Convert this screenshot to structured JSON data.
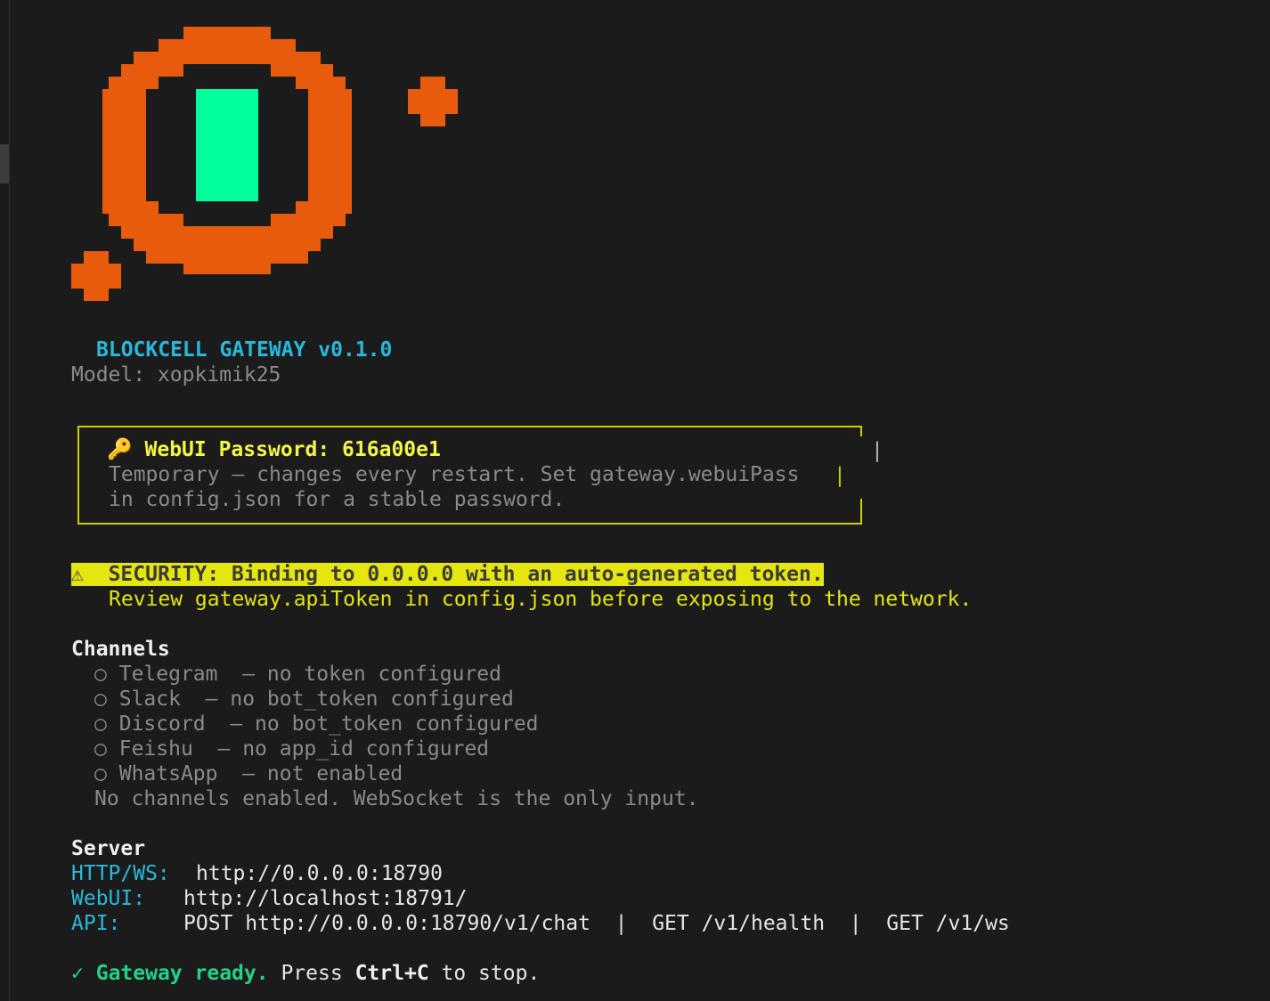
{
  "logo": {
    "name": "blockcell-pixel-logo-icon",
    "ring_color": "#e85b0c",
    "core_color": "#00ff9c"
  },
  "header": {
    "title": "BLOCKCELL GATEWAY v0.1.0",
    "model": "Model: xopkimik25"
  },
  "password_box": {
    "icon": "🔑",
    "label": "WebUI Password: 616a00e1",
    "line1": "Temporary — changes every restart. Set gateway.webuiPass",
    "line2": "in config.json for a stable password.",
    "border_color": "#cdcd00"
  },
  "security": {
    "icon": "⚠",
    "headline": "SECURITY: Binding to 0.0.0.0 with an auto-generated token.",
    "detail": "Review gateway.apiToken in config.json before exposing to the network."
  },
  "channels": {
    "heading": "Channels",
    "items": [
      {
        "bullet": "○",
        "text": "Telegram  — no token configured"
      },
      {
        "bullet": "○",
        "text": "Slack  — no bot_token configured"
      },
      {
        "bullet": "○",
        "text": "Discord  — no bot_token configured"
      },
      {
        "bullet": "○",
        "text": "Feishu  — no app_id configured"
      },
      {
        "bullet": "○",
        "text": "WhatsApp  — not enabled"
      }
    ],
    "note": "No channels enabled. WebSocket is the only input."
  },
  "server": {
    "heading": "Server",
    "http_label": "HTTP/WS:",
    "http_value": "http://0.0.0.0:18790",
    "webui_label": "WebUI:",
    "webui_value": "http://localhost:18791/",
    "api_label": "API:",
    "api_value": "POST http://0.0.0.0:18790/v1/chat  |  GET /v1/health  |  GET /v1/ws"
  },
  "status": {
    "check": "✓",
    "ready": "Gateway ready.",
    "press": "Press",
    "keys": "Ctrl+C",
    "tail": "to stop."
  }
}
